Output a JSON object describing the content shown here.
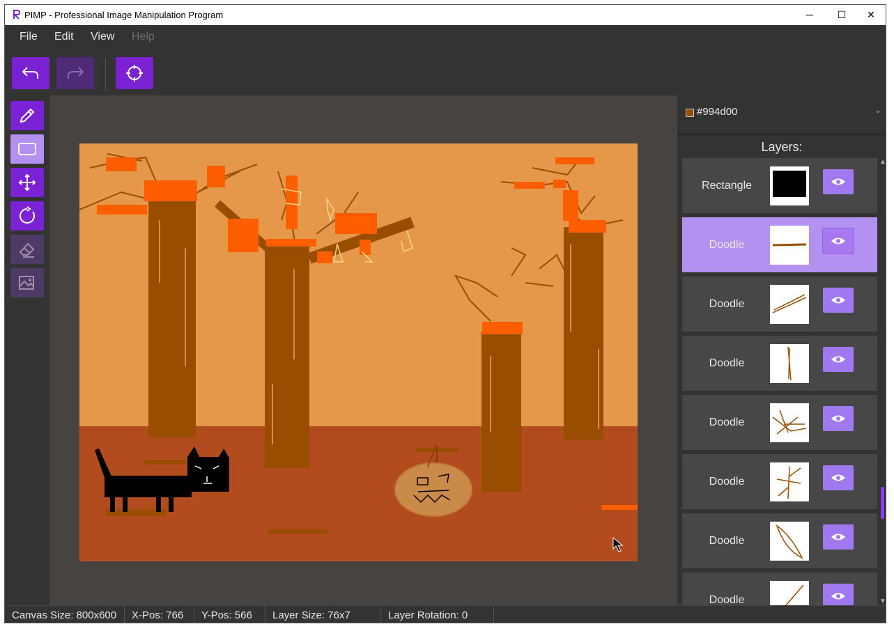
{
  "window": {
    "title": "PIMP - Professional Image Manipulation Program",
    "controls": [
      "─",
      "☐",
      "✕"
    ]
  },
  "menu": {
    "items": [
      "File",
      "Edit",
      "View",
      "Help"
    ],
    "disabled": [
      "Help"
    ]
  },
  "toolbar": {
    "buttons": [
      "undo-icon",
      "redo-icon",
      "crosshair-icon"
    ]
  },
  "tools": {
    "items": [
      "pencil-icon",
      "rectangle-icon",
      "move-icon",
      "rotate-icon",
      "eraser-icon",
      "image-icon"
    ],
    "active": "rectangle-icon"
  },
  "color": {
    "label": "#994d00",
    "value": "#994d00"
  },
  "layers": {
    "title": "Layers:",
    "items": [
      {
        "name": "Rectangle",
        "thumb": "black-rect"
      },
      {
        "name": "Doodle",
        "thumb": "horizontal-line",
        "selected": true
      },
      {
        "name": "Doodle",
        "thumb": "diagonal-strokes"
      },
      {
        "name": "Doodle",
        "thumb": "vertical-stroke"
      },
      {
        "name": "Doodle",
        "thumb": "branch-cluster"
      },
      {
        "name": "Doodle",
        "thumb": "branch-tree"
      },
      {
        "name": "Doodle",
        "thumb": "leaf-shape"
      },
      {
        "name": "Doodle",
        "thumb": "diagonal-line"
      }
    ]
  },
  "status": {
    "canvas_size": "Canvas Size: 800x600",
    "x_pos": "X-Pos: 766",
    "y_pos": "Y-Pos: 566",
    "layer_size": "Layer Size: 76x7",
    "layer_rotation": "Layer Rotation: 0"
  },
  "colors": {
    "accent": "#7b22d4",
    "accent_light": "#b391f0",
    "sky": "#e5974a",
    "ground": "#b24c1f",
    "trunk": "#994d00",
    "highlight": "#ff5e00"
  }
}
